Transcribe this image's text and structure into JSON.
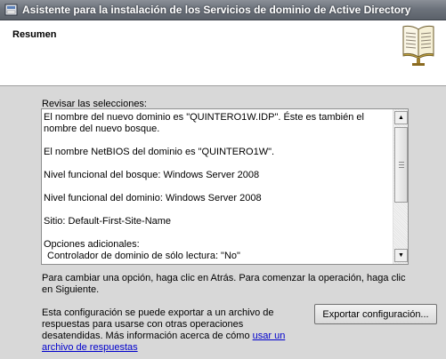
{
  "window": {
    "title": "Asistente para la instalación de los Servicios de dominio de Active Directory"
  },
  "header": {
    "title": "Resumen",
    "icon": "book-icon"
  },
  "review": {
    "label": "Revisar las selecciones:",
    "lines": [
      "El nombre del nuevo dominio es \"QUINTERO1W.IDP\". Éste es también el nombre del nuevo bosque.",
      "El nombre NetBIOS del dominio es \"QUINTERO1W\".",
      "Nivel funcional del bosque: Windows Server 2008",
      "Nivel funcional del dominio: Windows Server 2008",
      "Sitio: Default-First-Site-Name",
      "Opciones adicionales:",
      "Controlador de dominio de sólo lectura: \"No\""
    ]
  },
  "instructions": {
    "change": "Para cambiar una opción, haga clic en Atrás. Para comenzar la operación, haga clic en Siguiente.",
    "export_text": "Esta configuración se puede exportar a un archivo de respuestas para usarse con otras operaciones desatendidas. Más información acerca de cómo ",
    "export_link": "usar un archivo de respuestas"
  },
  "buttons": {
    "export": "Exportar configuración..."
  }
}
